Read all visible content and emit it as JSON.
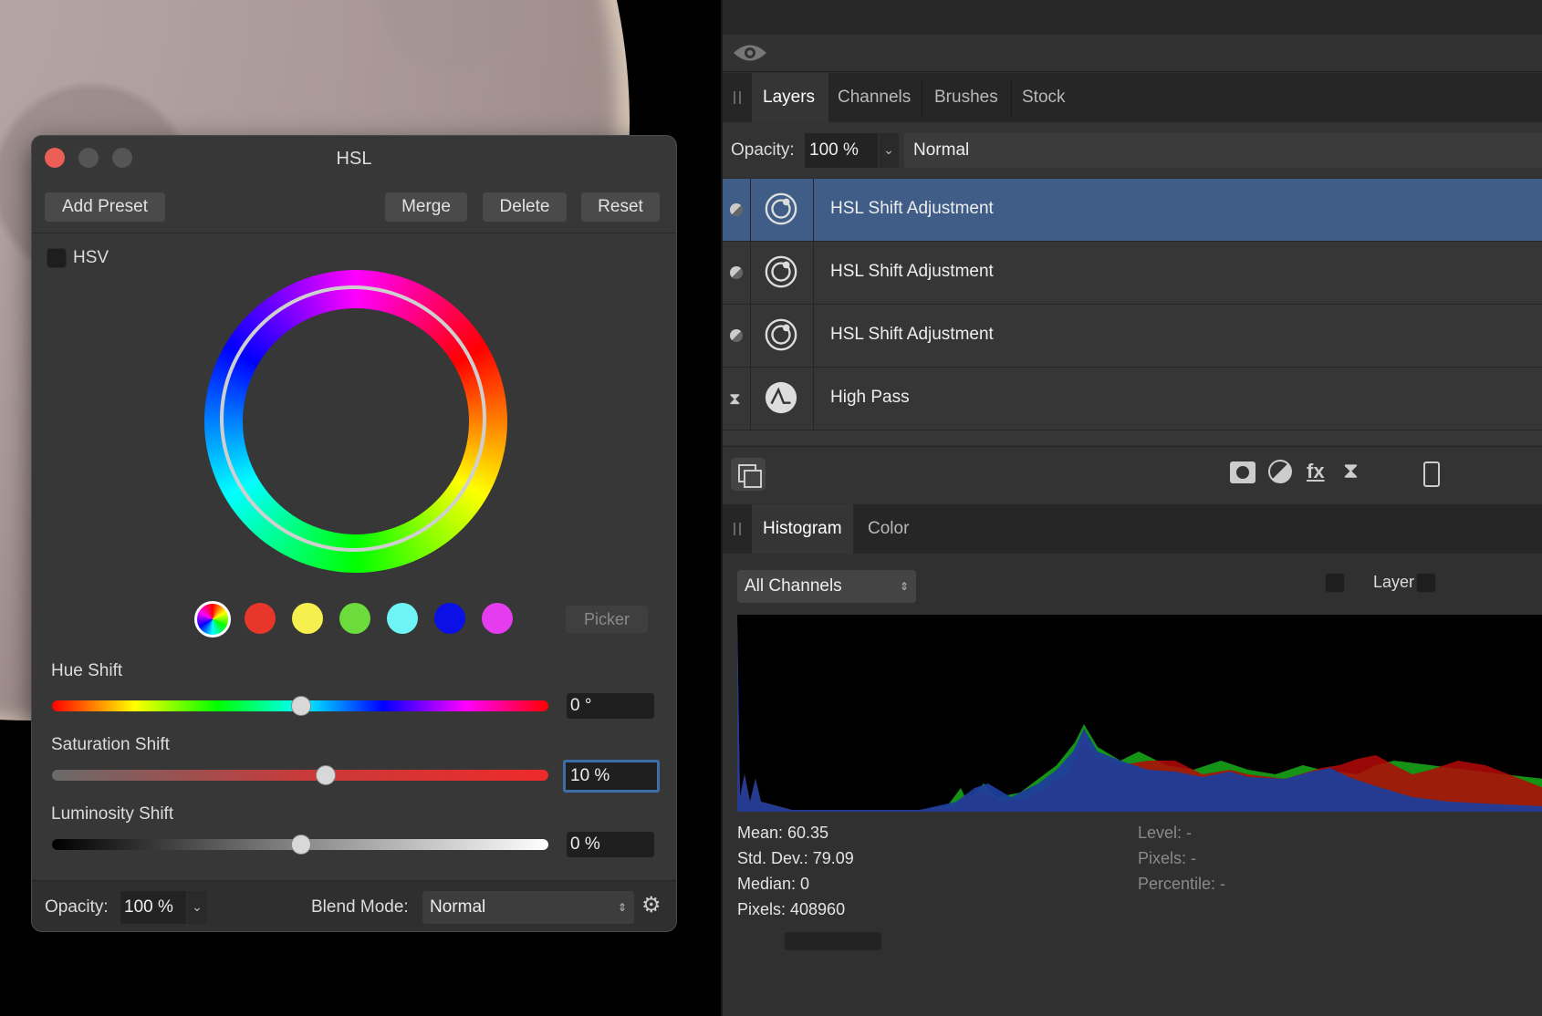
{
  "dialog": {
    "title": "HSL",
    "buttons": {
      "add_preset": "Add Preset",
      "merge": "Merge",
      "delete": "Delete",
      "reset": "Reset"
    },
    "hsv_label": "HSV",
    "picker": "Picker",
    "swatches": [
      "#e8372a",
      "#f6f04e",
      "#6cdc3c",
      "#6ef4f4",
      "#0a10e6",
      "#e53cf0"
    ],
    "hue_shift": {
      "label": "Hue Shift",
      "value": "0 °",
      "position": 0.5
    },
    "saturation_shift": {
      "label": "Saturation Shift",
      "value": "10 %",
      "position": 0.55
    },
    "luminosity_shift": {
      "label": "Luminosity Shift",
      "value": "0 %",
      "position": 0.5
    },
    "opacity_label": "Opacity:",
    "opacity_value": "100 %",
    "blend_mode_label": "Blend Mode:",
    "blend_mode_value": "Normal"
  },
  "layers_panel": {
    "tabs": [
      "Layers",
      "Channels",
      "Brushes",
      "Stock"
    ],
    "opacity_label": "Opacity:",
    "opacity_value": "100 %",
    "blend_mode": "Normal",
    "layers": [
      {
        "name": "HSL Shift Adjustment",
        "selected": true
      },
      {
        "name": "HSL Shift Adjustment",
        "selected": false
      },
      {
        "name": "HSL Shift Adjustment",
        "selected": false
      },
      {
        "name": "High Pass",
        "selected": false
      }
    ]
  },
  "histogram_panel": {
    "tabs": [
      "Histogram",
      "Color"
    ],
    "channel_select": "All Channels",
    "layer_label": "Layer",
    "stats": {
      "mean": "Mean: 60.35",
      "std_dev": "Std. Dev.: 79.09",
      "median": "Median: 0",
      "pixels": "Pixels: 408960",
      "level": "Level: -",
      "pixels2": "Pixels: -",
      "percentile": "Percentile: -"
    }
  }
}
